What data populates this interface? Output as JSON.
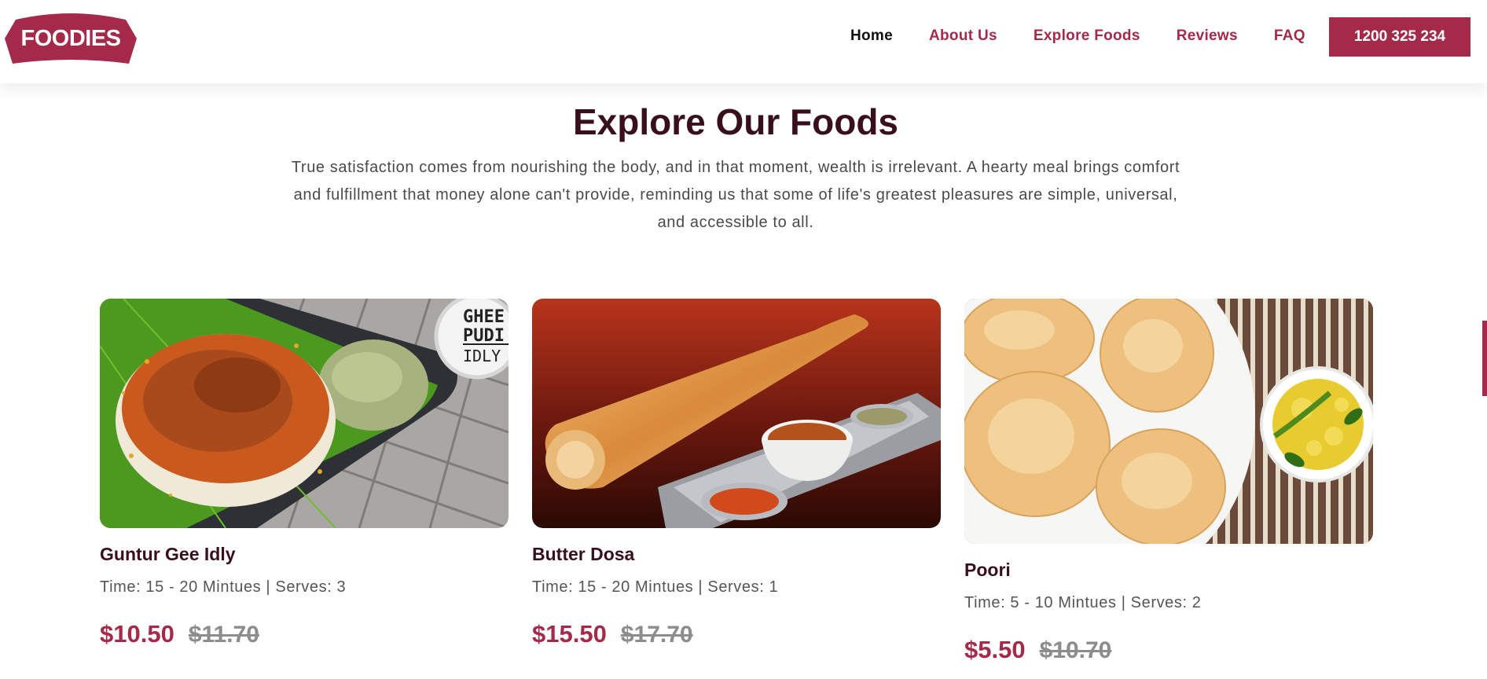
{
  "brand": {
    "logo_text": "FOODIES",
    "accent_color": "#a52a4a",
    "title_color": "#3a0f1c"
  },
  "nav": {
    "items": [
      {
        "label": "Home",
        "active": true
      },
      {
        "label": "About Us",
        "active": false
      },
      {
        "label": "Explore Foods",
        "active": false
      },
      {
        "label": "Reviews",
        "active": false
      },
      {
        "label": "FAQ",
        "active": false
      }
    ],
    "phone_label": "1200 325 234"
  },
  "section": {
    "title": "Explore Our Foods",
    "description": "True satisfaction comes from nourishing the body, and in that moment, wealth is irrelevant. A hearty meal brings comfort and fulfillment that money alone can't provide, reminding us that some of life's greatest pleasures are simple, universal, and accessible to all."
  },
  "foods": [
    {
      "name": "Guntur Gee Idly",
      "meta": "Time: 15 - 20 Mintues | Serves: 3",
      "price": "$10.50",
      "old_price": "$11.70",
      "photo_icon": "idly-plate-photo",
      "badge_lines": [
        "GHEE",
        "PUDI",
        "IDLY"
      ]
    },
    {
      "name": "Butter Dosa",
      "meta": "Time: 15 - 20 Mintues | Serves: 1",
      "price": "$15.50",
      "old_price": "$17.70",
      "photo_icon": "dosa-plate-photo"
    },
    {
      "name": "Poori",
      "meta": "Time: 5 - 10 Mintues | Serves: 2",
      "price": "$5.50",
      "old_price": "$10.70",
      "photo_icon": "poori-plate-photo"
    }
  ]
}
